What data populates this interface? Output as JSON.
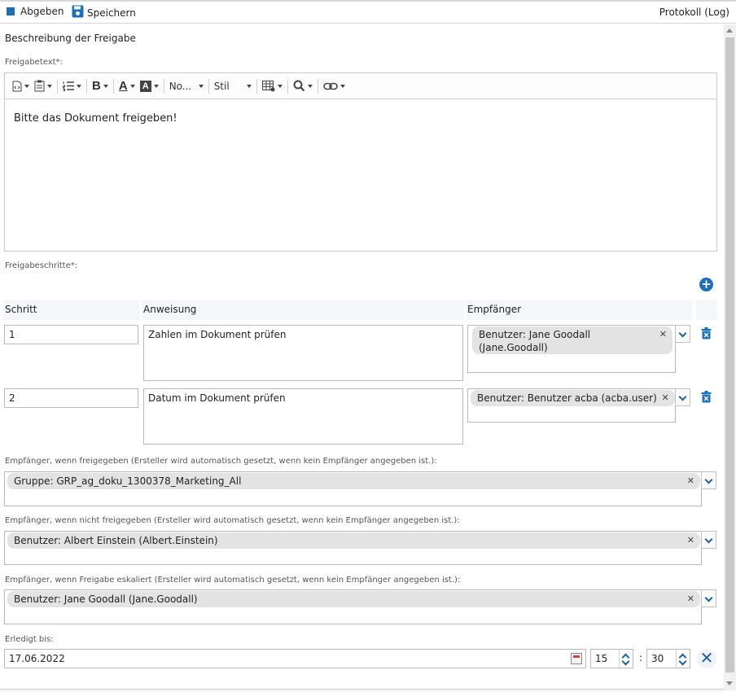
{
  "toolbar": {
    "submit_label": "Abgeben",
    "save_label": "Speichern",
    "log_label": "Protokoll (Log)"
  },
  "form": {
    "section_title": "Beschreibung der Freigabe",
    "text_label": "Freigabetext*:",
    "editor": {
      "font_label": "No...",
      "style_label": "Stil",
      "content": "Bitte das Dokument freigeben!"
    },
    "steps_label": "Freigabeschritte*:",
    "columns": {
      "step": "Schritt",
      "instruction": "Anweisung",
      "recipient": "Empfänger"
    },
    "steps": [
      {
        "step": "1",
        "instruction": "Zahlen im Dokument prüfen",
        "recipient": "Benutzer: Jane Goodall (Jane.Goodall)"
      },
      {
        "step": "2",
        "instruction": "Datum im Dokument prüfen",
        "recipient": "Benutzer: Benutzer acba (acba.user)"
      }
    ],
    "approved_label": "Empfänger, wenn freigegeben (Ersteller wird automatisch gesetzt, wenn kein Empfänger angegeben ist.):",
    "approved_value": "Gruppe: GRP_ag_doku_1300378_Marketing_All",
    "rejected_label": "Empfänger, wenn nicht freigegeben (Ersteller wird automatisch gesetzt, wenn kein Empfänger angegeben ist.):",
    "rejected_value": "Benutzer: Albert Einstein (Albert.Einstein)",
    "escalated_label": "Empfänger, wenn Freigabe eskaliert (Ersteller wird automatisch gesetzt, wenn kein Empfänger angegeben ist.):",
    "escalated_value": "Benutzer: Jane Goodall (Jane.Goodall)",
    "due_label": "Erledigt bis:",
    "due_date": "17.06.2022",
    "due_hour": "15",
    "due_minute": "30",
    "time_separator": ":"
  },
  "colors": {
    "accent": "#1f6fb5",
    "tag_bg": "#e3e3e3",
    "header_bg": "#f4f6fa"
  }
}
